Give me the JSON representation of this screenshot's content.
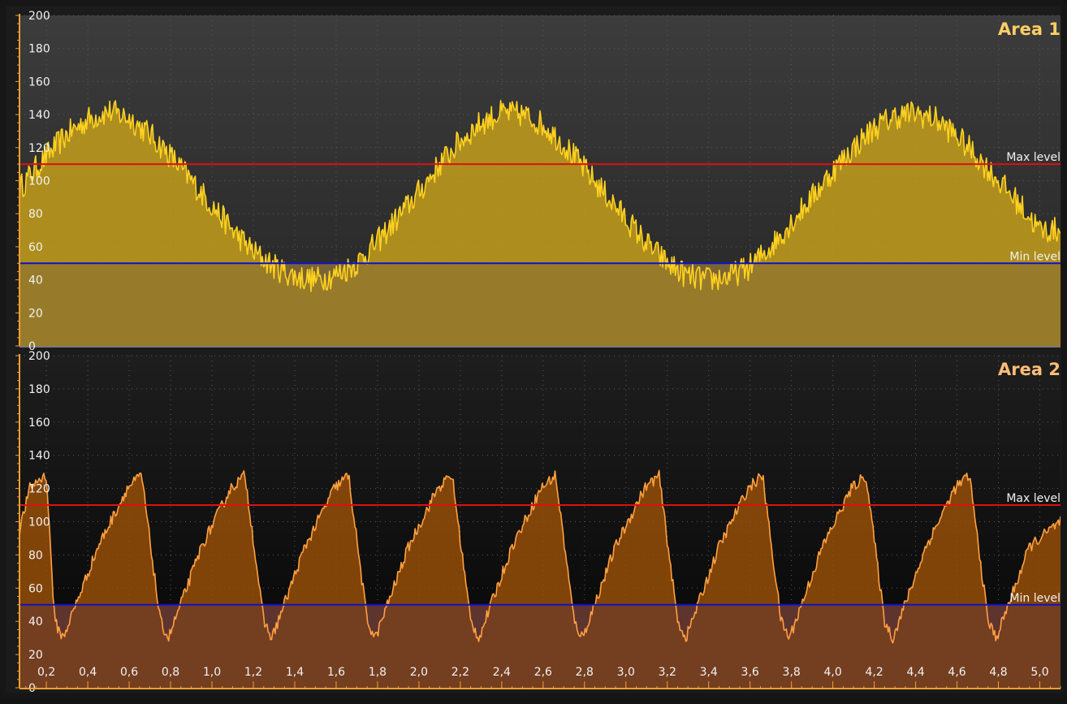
{
  "chart_data": [
    {
      "type": "area",
      "title": "Area 1",
      "title_color": "#ffcf66",
      "ylim": [
        0,
        200
      ],
      "yticks": [
        0,
        20,
        40,
        60,
        80,
        100,
        120,
        140,
        160,
        180,
        200
      ],
      "xlim": [
        0.07,
        5.1
      ],
      "grid": true,
      "series": [
        {
          "color": "#ffd21f",
          "fill": "#c9a21a",
          "x": [
            0.07,
            0.1,
            0.2,
            0.3,
            0.4,
            0.5,
            0.6,
            0.7,
            0.8,
            0.9,
            1.0,
            1.1,
            1.2,
            1.3,
            1.4,
            1.5,
            1.6,
            1.7,
            1.8,
            1.9,
            2.0,
            2.1,
            2.2,
            2.3,
            2.4,
            2.5,
            2.6,
            2.7,
            2.8,
            2.9,
            3.0,
            3.1,
            3.2,
            3.3,
            3.4,
            3.5,
            3.6,
            3.7,
            3.8,
            3.9,
            4.0,
            4.1,
            4.2,
            4.3,
            4.4,
            4.5,
            4.6,
            4.7,
            4.8,
            4.9,
            5.0,
            5.1
          ],
          "values": [
            95,
            100,
            115,
            128,
            137,
            142,
            138,
            128,
            115,
            100,
            85,
            70,
            57,
            48,
            42,
            40,
            43,
            50,
            63,
            78,
            93,
            110,
            124,
            135,
            141,
            140,
            134,
            122,
            107,
            92,
            77,
            62,
            50,
            42,
            40,
            42,
            48,
            60,
            75,
            90,
            106,
            120,
            132,
            139,
            141,
            137,
            127,
            114,
            100,
            86,
            70,
            70
          ]
        }
      ],
      "levels": [
        {
          "label": "Max level",
          "value": 110,
          "color": "#e01010"
        },
        {
          "label": "Min level",
          "value": 50,
          "color": "#1010c8"
        }
      ],
      "band": {
        "from": 0,
        "to": 50,
        "fill": "#7a6535"
      }
    },
    {
      "type": "area",
      "title": "Area 2",
      "title_color": "#ffbe78",
      "ylim": [
        0,
        200
      ],
      "yticks": [
        0,
        20,
        40,
        60,
        80,
        100,
        120,
        140,
        160,
        180,
        200
      ],
      "xlim": [
        0.07,
        5.1
      ],
      "xticks": [
        "0,2",
        "0,4",
        "0,6",
        "0,8",
        "1,0",
        "1,2",
        "1,4",
        "1,6",
        "1,8",
        "2,0",
        "2,2",
        "2,4",
        "2,6",
        "2,8",
        "3,0",
        "3,2",
        "3,4",
        "3,6",
        "3,8",
        "4,0",
        "4,2",
        "4,4",
        "4,6",
        "4,8",
        "5,0"
      ],
      "xtick_values": [
        0.2,
        0.4,
        0.6,
        0.8,
        1.0,
        1.2,
        1.4,
        1.6,
        1.8,
        2.0,
        2.2,
        2.4,
        2.6,
        2.8,
        3.0,
        3.2,
        3.4,
        3.6,
        3.8,
        4.0,
        4.2,
        4.4,
        4.6,
        4.8,
        5.0
      ],
      "grid": true,
      "series": [
        {
          "color": "#ffa040",
          "fill": "#9a5008",
          "x": [
            0.07,
            0.12,
            0.16,
            0.2,
            0.24,
            0.28,
            0.45,
            0.59,
            0.66,
            0.75,
            0.79,
            0.95,
            1.09,
            1.16,
            1.25,
            1.29,
            1.45,
            1.59,
            1.66,
            1.75,
            1.79,
            1.95,
            2.09,
            2.16,
            2.25,
            2.29,
            2.45,
            2.59,
            2.66,
            2.75,
            2.79,
            2.95,
            3.09,
            3.16,
            3.25,
            3.29,
            3.45,
            3.59,
            3.66,
            3.75,
            3.79,
            3.95,
            4.09,
            4.16,
            4.25,
            4.29,
            4.45,
            4.59,
            4.66,
            4.75,
            4.79,
            4.95,
            5.1
          ],
          "values": [
            95,
            120,
            125,
            128,
            40,
            30,
            85,
            120,
            128,
            40,
            30,
            85,
            120,
            128,
            40,
            30,
            85,
            120,
            128,
            40,
            30,
            85,
            120,
            128,
            40,
            30,
            85,
            120,
            128,
            40,
            30,
            85,
            120,
            128,
            40,
            30,
            85,
            120,
            128,
            40,
            30,
            85,
            120,
            128,
            40,
            30,
            85,
            120,
            128,
            40,
            30,
            85,
            100
          ]
        }
      ],
      "levels": [
        {
          "label": "Max level",
          "value": 110,
          "color": "#e01010"
        },
        {
          "label": "Min level",
          "value": 50,
          "color": "#1010c8"
        }
      ],
      "band": {
        "from": 0,
        "to": 50,
        "fill": "#5e3430"
      }
    }
  ]
}
